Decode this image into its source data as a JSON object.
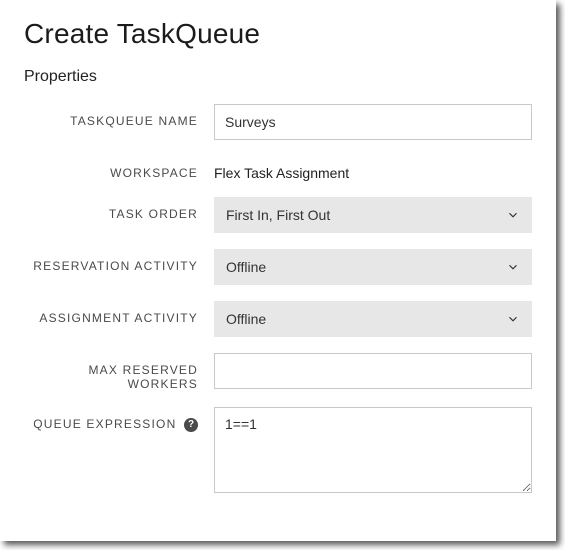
{
  "title": "Create TaskQueue",
  "section": "Properties",
  "fields": {
    "name": {
      "label": "TaskQueue Name",
      "value": "Surveys"
    },
    "workspace": {
      "label": "Workspace",
      "value": "Flex Task Assignment"
    },
    "taskOrder": {
      "label": "Task Order",
      "selected": "First In, First Out"
    },
    "reservationActivity": {
      "label": "Reservation Activity",
      "selected": "Offline"
    },
    "assignmentActivity": {
      "label": "Assignment Activity",
      "selected": "Offline"
    },
    "maxReservedWorkers": {
      "label": "Max Reserved Workers",
      "value": ""
    },
    "queueExpression": {
      "label": "Queue Expression",
      "value": "1==1",
      "helpGlyph": "?"
    }
  }
}
